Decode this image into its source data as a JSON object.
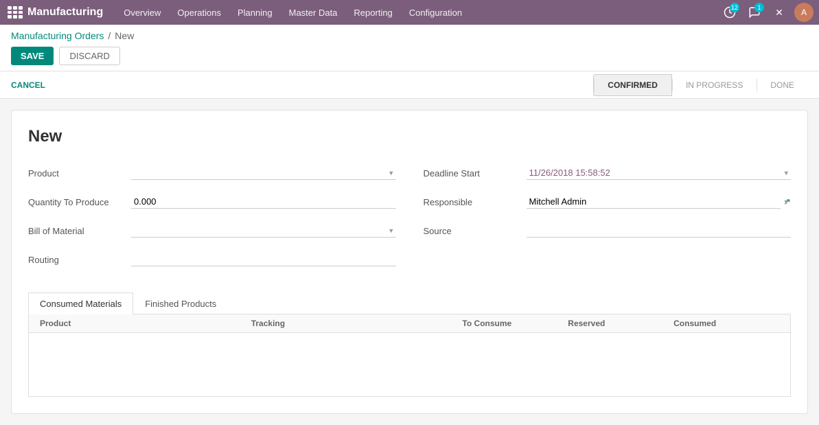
{
  "app": {
    "name": "Manufacturing"
  },
  "navbar": {
    "menu": [
      {
        "label": "Overview",
        "id": "overview"
      },
      {
        "label": "Operations",
        "id": "operations"
      },
      {
        "label": "Planning",
        "id": "planning"
      },
      {
        "label": "Master Data",
        "id": "master-data"
      },
      {
        "label": "Reporting",
        "id": "reporting"
      },
      {
        "label": "Configuration",
        "id": "configuration"
      }
    ],
    "notifications_count": "12",
    "messages_count": "1"
  },
  "breadcrumb": {
    "parent": "Manufacturing Orders",
    "separator": "/",
    "current": "New"
  },
  "buttons": {
    "save": "SAVE",
    "discard": "DISCARD",
    "cancel": "CANCEL"
  },
  "status_steps": [
    {
      "label": "CONFIRMED",
      "active": true
    },
    {
      "label": "IN PROGRESS",
      "active": false
    },
    {
      "label": "DONE",
      "active": false
    }
  ],
  "form": {
    "title": "New",
    "fields": {
      "product_label": "Product",
      "product_value": "",
      "quantity_label": "Quantity To Produce",
      "quantity_value": "0.000",
      "bom_label": "Bill of Material",
      "bom_value": "",
      "routing_label": "Routing",
      "routing_value": "",
      "deadline_label": "Deadline Start",
      "deadline_value": "11/26/2018 15:58:52",
      "responsible_label": "Responsible",
      "responsible_value": "Mitchell Admin",
      "source_label": "Source",
      "source_value": ""
    }
  },
  "tabs": [
    {
      "label": "Consumed Materials",
      "active": true
    },
    {
      "label": "Finished Products",
      "active": false
    }
  ],
  "table": {
    "columns": [
      "Product",
      "Tracking",
      "To Consume",
      "Reserved",
      "Consumed"
    ]
  }
}
